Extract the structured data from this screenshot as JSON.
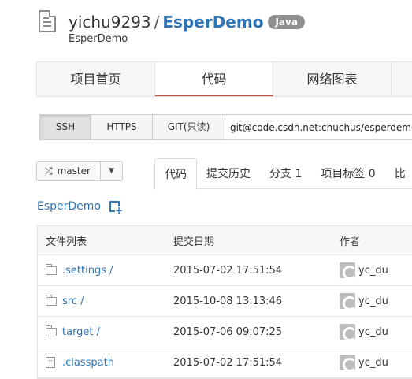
{
  "header": {
    "owner": "yichu9293",
    "separator": "/",
    "repo_name": "EsperDemo",
    "language_badge": "Java",
    "description": "EsperDemo"
  },
  "main_nav": [
    {
      "label": "项目首页",
      "active": false
    },
    {
      "label": "代码",
      "active": true
    },
    {
      "label": "网络图表",
      "active": false
    }
  ],
  "clone": {
    "protocols": [
      {
        "label": "SSH",
        "active": true
      },
      {
        "label": "HTTPS",
        "active": false
      },
      {
        "label": "GIT(只读)",
        "active": false
      }
    ],
    "url": "git@code.csdn.net:chuchus/esperdemo.git"
  },
  "branch": {
    "icon": "shuffle-icon",
    "name": "master",
    "caret": "▼"
  },
  "sub_tabs": [
    {
      "label": "代码",
      "active": true
    },
    {
      "label": "提交历史",
      "active": false
    },
    {
      "label": "分支 1",
      "active": false
    },
    {
      "label": "项目标签 0",
      "active": false
    },
    {
      "label": "比",
      "active": false
    }
  ],
  "breadcrumb": {
    "root": "EsperDemo",
    "new_file_icon": "new-file-icon"
  },
  "file_table": {
    "headers": [
      "文件列表",
      "提交日期",
      "作者"
    ],
    "rows": [
      {
        "type": "folder",
        "name": ".settings /",
        "date": "2015-07-02 17:51:54",
        "author": "yc_du"
      },
      {
        "type": "folder",
        "name": "src /",
        "date": "2015-10-08 13:13:46",
        "author": "yc_du"
      },
      {
        "type": "folder",
        "name": "target /",
        "date": "2015-07-06 09:07:25",
        "author": "yc_du"
      },
      {
        "type": "file",
        "name": ".classpath",
        "date": "2015-07-02 17:51:54",
        "author": "yc_du"
      }
    ]
  },
  "colors": {
    "link": "#2f74b5",
    "active_underline": "#c9403a",
    "badge": "#8f8f8f"
  }
}
